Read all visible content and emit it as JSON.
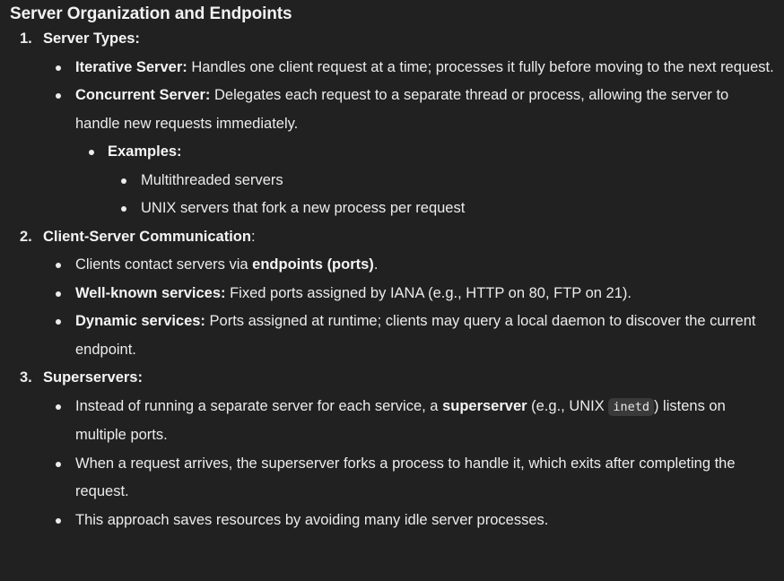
{
  "title": "Server Organization and Endpoints",
  "sections": [
    {
      "number": "1.",
      "heading": "Server Types:",
      "items": [
        {
          "label": "Iterative Server:",
          "text": " Handles one client request at a time; processes it fully before moving to the next request."
        },
        {
          "label": "Concurrent Server:",
          "text": " Delegates each request to a separate thread or process, allowing the server to handle new requests immediately.",
          "sub_label": "Examples:",
          "examples": [
            "Multithreaded servers",
            "UNIX servers that fork a new process per request"
          ]
        }
      ]
    },
    {
      "number": "2.",
      "heading": "Client-Server Communication",
      "heading_suffix": ":",
      "items": [
        {
          "pre": "Clients contact servers via ",
          "bold": "endpoints (ports)",
          "post": "."
        },
        {
          "label": "Well-known services:",
          "text": " Fixed ports assigned by IANA (e.g., HTTP on 80, FTP on 21)."
        },
        {
          "label": "Dynamic services:",
          "text": " Ports assigned at runtime; clients may query a local daemon to discover the current endpoint."
        }
      ]
    },
    {
      "number": "3.",
      "heading": "Superservers:",
      "items": [
        {
          "pre": "Instead of running a separate server for each service, a ",
          "bold": "superserver",
          "mid": " (e.g., UNIX ",
          "code": "inetd",
          "post": ") listens on multiple ports."
        },
        {
          "text": "When a request arrives, the superserver forks a process to handle it, which exits after completing the request."
        },
        {
          "text": "This approach saves resources by avoiding many idle server processes."
        }
      ]
    }
  ]
}
